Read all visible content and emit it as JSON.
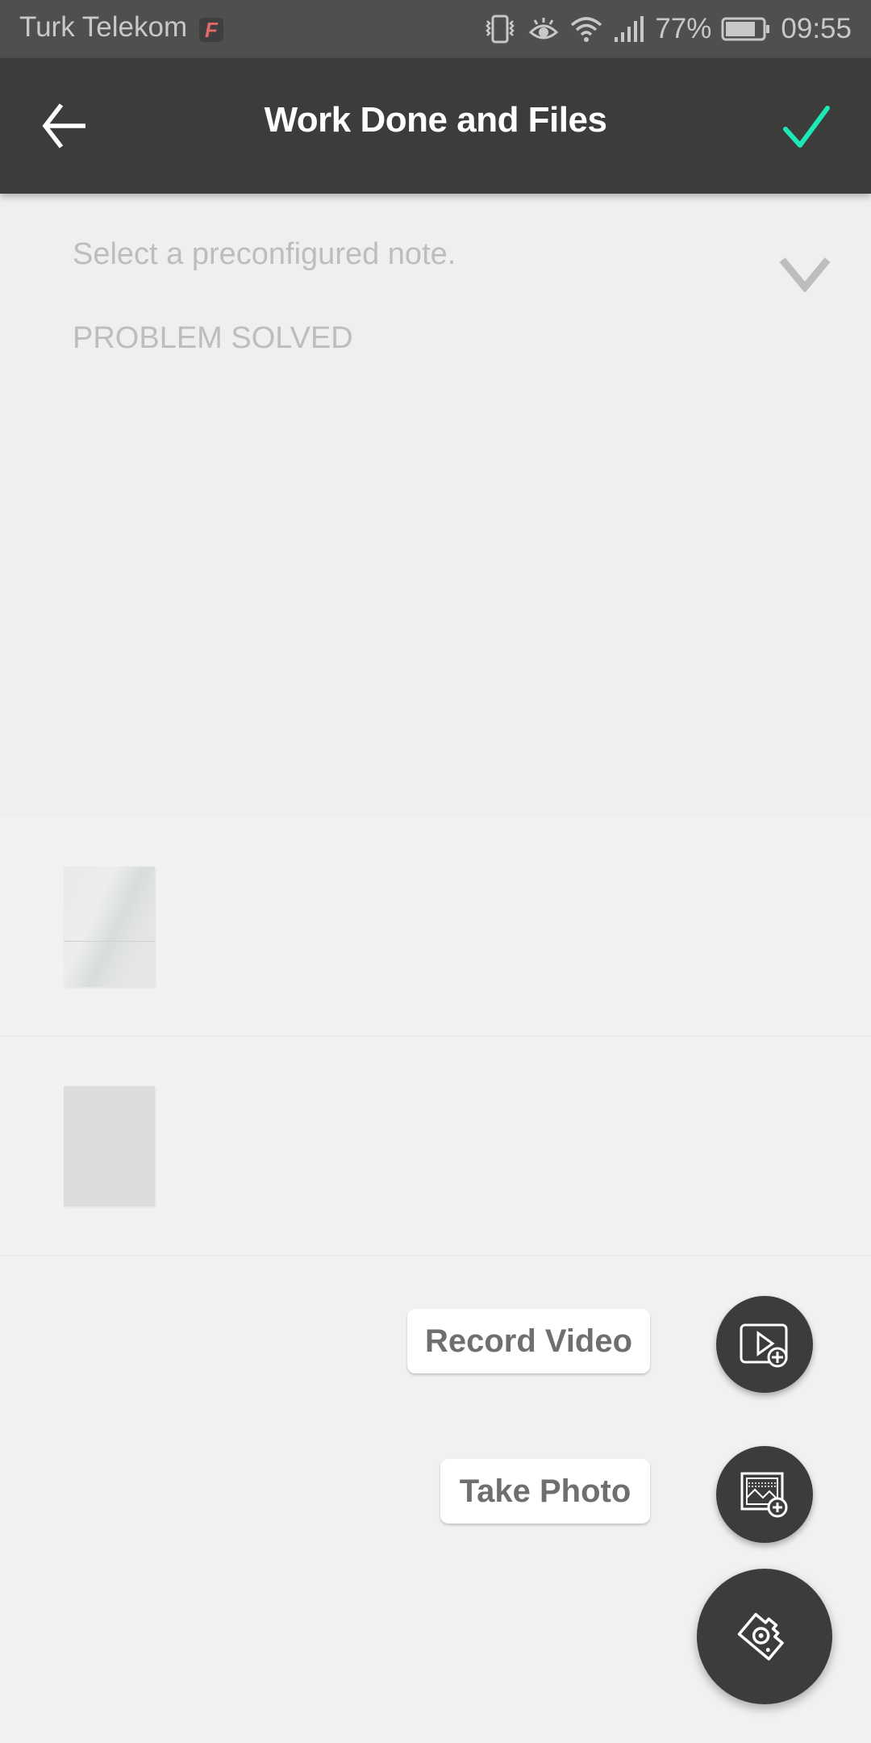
{
  "status_bar": {
    "carrier": "Turk Telekom",
    "carrier_badge": "F",
    "icons": [
      "vibrate-icon",
      "eye-comfort-icon",
      "wifi-icon",
      "signal-icon",
      "battery-icon"
    ],
    "battery_percent": "77%",
    "time": "09:55"
  },
  "app_bar": {
    "title": "Work Done and Files",
    "back_icon": "arrow-left-icon",
    "confirm_icon": "check-icon",
    "confirm_color": "#1de9b6"
  },
  "note": {
    "select_placeholder": "Select a preconfigured note.",
    "text": "PROBLEM SOLVED"
  },
  "files": [
    {
      "type": "image-thumbnail"
    },
    {
      "type": "image-thumbnail"
    }
  ],
  "fab_menu": {
    "record_video_label": "Record Video",
    "take_photo_label": "Take Photo",
    "record_video_icon": "video-add-icon",
    "take_photo_icon": "image-add-icon",
    "main_icon": "camera-icon"
  }
}
